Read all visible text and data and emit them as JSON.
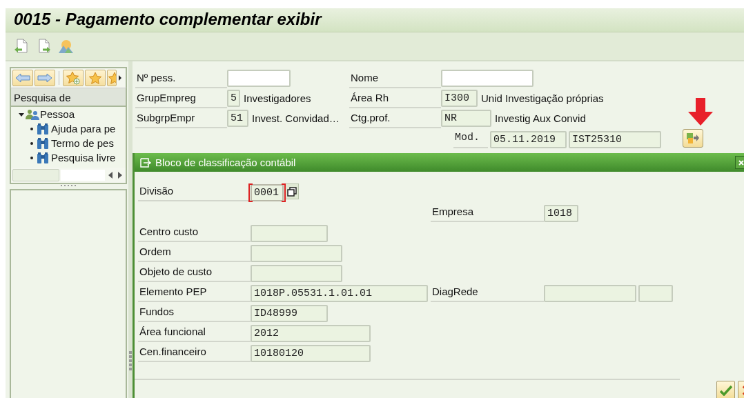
{
  "window": {
    "title": "0015 - Pagamento complementar exibir"
  },
  "navigator": {
    "header": "Pesquisa de",
    "tree": [
      {
        "label": "Pessoa",
        "expanded": true,
        "children": [
          {
            "label": "Ajuda para pe"
          },
          {
            "label": "Termo de pes"
          },
          {
            "label": "Pesquisa livre"
          }
        ]
      }
    ]
  },
  "header": {
    "fields": [
      {
        "label": "Nº pess.",
        "redacted": true
      },
      {
        "label": "Nome",
        "redacted": true
      },
      {
        "label": "GrupEmpreg",
        "value": "5",
        "text": "Investigadores",
        "redacted": false
      },
      {
        "label": "Área Rh",
        "value": "I300",
        "text": "Unid Investigação próprias",
        "redacted": false
      },
      {
        "label": "SubgrpEmpr",
        "value": "51",
        "text": "Invest. Convidad…",
        "redacted": false
      },
      {
        "label": "Ctg.prof.",
        "value": "NR",
        "text": "Investig Aux Convid",
        "redacted": false
      }
    ],
    "modified": {
      "label": "Mod.",
      "date": "05.11.2019",
      "user": "IST25310"
    }
  },
  "dialog": {
    "title": "Bloco de classificação contábil",
    "fields": [
      {
        "label": "Divisão",
        "value": "0001",
        "focused": true
      },
      {
        "label": "Empresa",
        "value": "1018",
        "focused": false
      },
      {
        "label": "Centro custo",
        "focused": false
      },
      {
        "label": "Ordem",
        "focused": false
      },
      {
        "label": "Objeto de custo",
        "focused": false
      },
      {
        "label": "Elemento PEP",
        "value": "1018P.05531.1.01.01",
        "focused": false
      },
      {
        "label": "DiagRede",
        "focused": false
      },
      {
        "label": "Fundos",
        "value": "ID48999",
        "focused": false
      },
      {
        "label": "Área funcional",
        "value": "2012",
        "focused": false
      },
      {
        "label": "Cen.financeiro",
        "value": "10180120",
        "focused": false
      }
    ]
  }
}
